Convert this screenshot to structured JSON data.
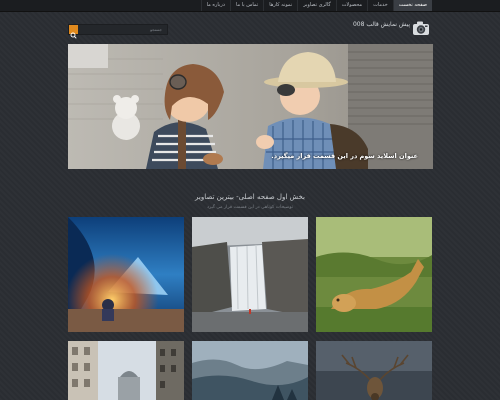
{
  "nav": {
    "items": [
      {
        "label": "صفحه نخست",
        "active": true
      },
      {
        "label": "خدمات",
        "active": false
      },
      {
        "label": "محصولات",
        "active": false
      },
      {
        "label": "گالری تصاویر",
        "active": false
      },
      {
        "label": "نمونه کارها",
        "active": false
      },
      {
        "label": "تماس با ما",
        "active": false
      },
      {
        "label": "درباره ما",
        "active": false
      }
    ]
  },
  "header": {
    "site_title": "پیش نمایش قالب 008",
    "logo_icon": "camera-icon",
    "search": {
      "placeholder": "جستجو",
      "button_icon": "search-icon"
    }
  },
  "slider": {
    "caption": "عنوان اسلاید سوم در این قسمت قرار میگیرد."
  },
  "gallery": {
    "title": "بخش اول صفحه اصلی- بیترین تصاویر",
    "subtitle": "توضیحات کوتاهی در این قسمت قرار می گیرد",
    "images": [
      {
        "subject": "ice-cave-with-campfire"
      },
      {
        "subject": "waterfall"
      },
      {
        "subject": "lion-cub-in-grass"
      },
      {
        "subject": "city-buildings"
      },
      {
        "subject": "misty-mountains"
      },
      {
        "subject": "deer-antlers"
      }
    ]
  },
  "colors": {
    "background": "#2b2e33",
    "topbar": "#1b1d20",
    "accent": "#e08a1e"
  }
}
